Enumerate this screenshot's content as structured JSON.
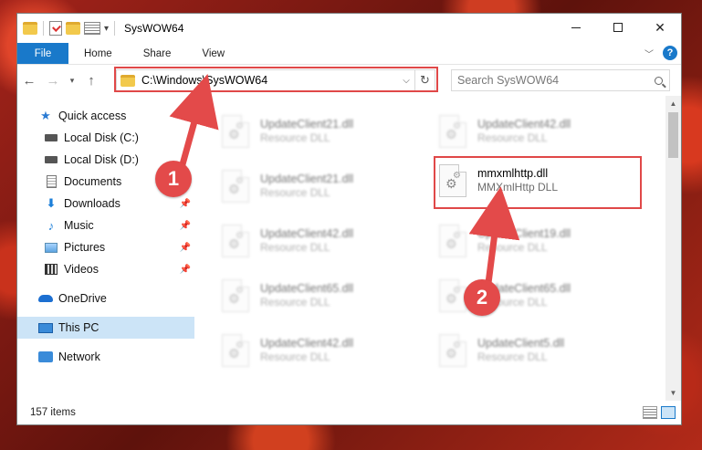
{
  "window": {
    "title": "SysWOW64"
  },
  "ribbon": {
    "tabs": [
      "File",
      "Home",
      "Share",
      "View"
    ],
    "help": "?"
  },
  "navbar": {
    "address": "C:\\Windows\\SysWOW64",
    "search_placeholder": "Search SysWOW64"
  },
  "sidebar": {
    "items": [
      {
        "label": "Quick access",
        "icon": "star-icon"
      },
      {
        "label": "Local Disk (C:)",
        "icon": "disk-icon"
      },
      {
        "label": "Local Disk (D:)",
        "icon": "disk-icon"
      },
      {
        "label": "Documents",
        "icon": "document-icon",
        "pinned": true
      },
      {
        "label": "Downloads",
        "icon": "download-icon",
        "pinned": true
      },
      {
        "label": "Music",
        "icon": "music-icon",
        "pinned": true
      },
      {
        "label": "Pictures",
        "icon": "pictures-icon",
        "pinned": true
      },
      {
        "label": "Videos",
        "icon": "videos-icon",
        "pinned": true
      },
      {
        "label": "OneDrive",
        "icon": "onedrive-icon"
      },
      {
        "label": "This PC",
        "icon": "computer-icon",
        "selected": true
      },
      {
        "label": "Network",
        "icon": "network-icon"
      }
    ]
  },
  "files": [
    {
      "name": "UpdateClient21.dll",
      "type": "Resource DLL",
      "blurred": true
    },
    {
      "name": "UpdateClient42.dll",
      "type": "Resource DLL",
      "blurred": true
    },
    {
      "name": "UpdateClient21.dll",
      "type": "Resource DLL",
      "blurred": true
    },
    {
      "name": "mmxmlhttp.dll",
      "type": "MMXmlHttp DLL",
      "blurred": false
    },
    {
      "name": "UpdateClient42.dll",
      "type": "Resource DLL",
      "blurred": true
    },
    {
      "name": "UpdateClient19.dll",
      "type": "Resource DLL",
      "blurred": true
    },
    {
      "name": "UpdateClient65.dll",
      "type": "Resource DLL",
      "blurred": true
    },
    {
      "name": "UpdateClient65.dll",
      "type": "Resource DLL",
      "blurred": true
    },
    {
      "name": "UpdateClient42.dll",
      "type": "Resource DLL",
      "blurred": true
    },
    {
      "name": "UpdateClient5.dll",
      "type": "Resource DLL",
      "blurred": true
    }
  ],
  "status": {
    "item_count": "157 items"
  },
  "annotations": {
    "step1": "1",
    "step2": "2",
    "highlight_color": "#e04848"
  }
}
